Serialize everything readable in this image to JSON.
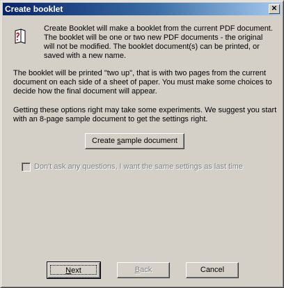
{
  "window": {
    "title": "Create booklet",
    "close_glyph": "✕"
  },
  "intro": "Create Booklet will make a booklet from the current PDF document. The booklet will be one or two new PDF documents - the original will not be modified. The booklet document(s) can be printed, or saved with a new name.",
  "two_up": "The booklet will be printed \"two up\", that is with two pages from the current document on each side of a sheet of paper. You must make some choices to decide how the final document will appear.",
  "experiments": "Getting these options right may take some experiments. We suggest you start with an 8-page sample document to get the settings right.",
  "buttons": {
    "sample_pre": "Create ",
    "sample_acc": "s",
    "sample_post": "ample document",
    "next_acc": "N",
    "next_post": "ext",
    "back_acc": "B",
    "back_post": "ack",
    "cancel": "Cancel"
  },
  "checkbox": {
    "label": "Don't ask any questions, I want the same settings as last time",
    "checked": false,
    "enabled": false
  },
  "icons": {
    "document": "booklet-document-icon",
    "close": "close-icon"
  },
  "colors": {
    "titlebar_start": "#0a246a",
    "titlebar_end": "#a6caf0",
    "face": "#d4d0c8",
    "icon_red": "#c00000"
  }
}
